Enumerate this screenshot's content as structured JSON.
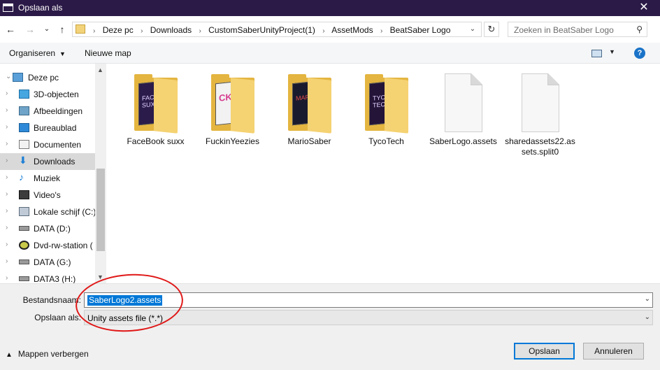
{
  "window": {
    "title": "Opslaan als",
    "close_glyph": "✕"
  },
  "nav": {
    "back_glyph": "←",
    "forward_glyph": "→",
    "recent_glyph": "⌄",
    "up_glyph": "↑",
    "breadcrumbs": [
      "Deze pc",
      "Downloads",
      "CustomSaberUnityProject(1)",
      "AssetMods",
      "BeatSaber Logo"
    ],
    "refresh_glyph": "↻",
    "search_placeholder": "Zoeken in BeatSaber Logo"
  },
  "toolbar": {
    "organize_label": "Organiseren",
    "new_folder_label": "Nieuwe map",
    "help_label": "?"
  },
  "sidebar": {
    "items": [
      {
        "label": "Deze pc",
        "icon": "computer-icon",
        "expanded": true
      },
      {
        "label": "3D-objecten",
        "icon": "3d-objects-icon"
      },
      {
        "label": "Afbeeldingen",
        "icon": "pictures-icon"
      },
      {
        "label": "Bureaublad",
        "icon": "desktop-icon"
      },
      {
        "label": "Documenten",
        "icon": "documents-icon"
      },
      {
        "label": "Downloads",
        "icon": "downloads-icon",
        "selected": true
      },
      {
        "label": "Muziek",
        "icon": "music-icon"
      },
      {
        "label": "Video's",
        "icon": "videos-icon"
      },
      {
        "label": "Lokale schijf (C:)",
        "icon": "local-disk-icon"
      },
      {
        "label": "DATA (D:)",
        "icon": "drive-icon"
      },
      {
        "label": "Dvd-rw-station (",
        "icon": "dvd-drive-icon"
      },
      {
        "label": "DATA (G:)",
        "icon": "drive-icon"
      },
      {
        "label": "DATA3 (H:)",
        "icon": "drive-icon"
      }
    ]
  },
  "files": [
    {
      "name": "FaceBook suxx",
      "type": "folder",
      "preview": "FACEBOOK SUXX",
      "color": "#2a1b4a"
    },
    {
      "name": "FuckinYeezies",
      "type": "folder",
      "preview": "CKZ",
      "color": "#f2f2f2"
    },
    {
      "name": "MarioSaber",
      "type": "folder",
      "preview": "MARIO",
      "color": "#1a1a2e"
    },
    {
      "name": "TycoTech",
      "type": "folder",
      "preview": "TYCO TECH",
      "color": "#241438"
    },
    {
      "name": "SaberLogo.assets",
      "type": "file"
    },
    {
      "name": "sharedassets22.assets.split0",
      "display": "sharedassets22.as sets.split0",
      "type": "file"
    }
  ],
  "bottom": {
    "filename_label": "Bestandsnaam:",
    "filename_value": "SaberLogo2.assets",
    "filetype_label": "Opslaan als:",
    "filetype_value": "Unity assets file (*.*)",
    "hide_folders_label": "Mappen verbergen",
    "save_label": "Opslaan",
    "cancel_label": "Annuleren"
  },
  "colors": {
    "titlebar": "#2b1a47",
    "selection": "#0078d7",
    "annotation": "#e01818",
    "folder": "#e4b540"
  }
}
